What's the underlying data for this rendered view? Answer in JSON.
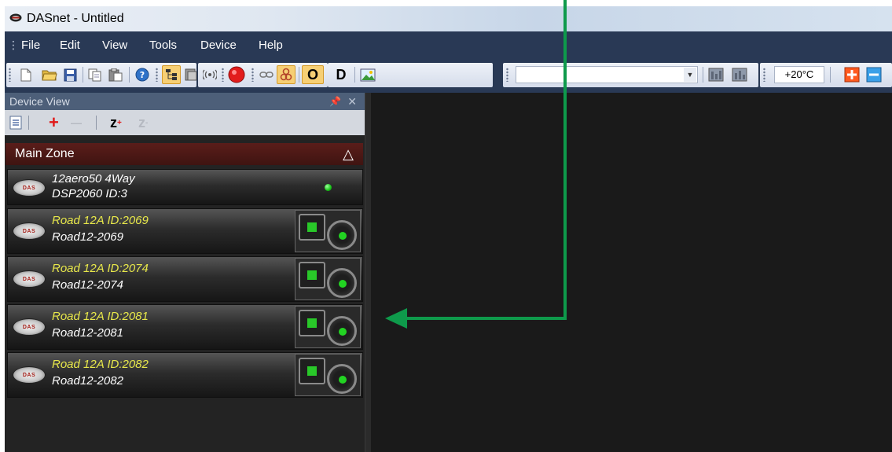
{
  "window": {
    "title": "DASnet - Untitled"
  },
  "menu": {
    "items": [
      "File",
      "Edit",
      "View",
      "Tools",
      "Device",
      "Help"
    ]
  },
  "toolbar": {
    "letter_o": "O",
    "letter_d": "D",
    "combo_value": "",
    "temperature": "+20°C",
    "plus_color": "#ff5a1f",
    "minus_color": "#3aa0e8"
  },
  "panel": {
    "title": "Device View",
    "pin_glyph": "ᵖ",
    "close_glyph": "✕",
    "tools": {
      "add": "+",
      "remove": "—",
      "zoom_in": "z",
      "zoom_out": "z"
    }
  },
  "zone": {
    "name": "Main Zone",
    "toggle": "△"
  },
  "devices": [
    {
      "line1": "12aero50 4Way",
      "line2": "DSP2060  ID:3",
      "status": "online"
    },
    {
      "line1": "Road 12A  ID:2069",
      "line2": "Road12-2069",
      "status": "online"
    },
    {
      "line1": "Road 12A  ID:2074",
      "line2": "Road12-2074",
      "status": "online"
    },
    {
      "line1": "Road 12A  ID:2081",
      "line2": "Road12-2081",
      "status": "online"
    },
    {
      "line1": "Road 12A  ID:2082",
      "line2": "Road12-2082",
      "status": "online"
    }
  ],
  "logo_text": "DAS",
  "annotation": {
    "color": "#0e9a4b"
  },
  "colors": {
    "led_green": "#17c417",
    "zone_bar": "#5a1d1a",
    "device_name_yellow": "#e8e84a"
  }
}
